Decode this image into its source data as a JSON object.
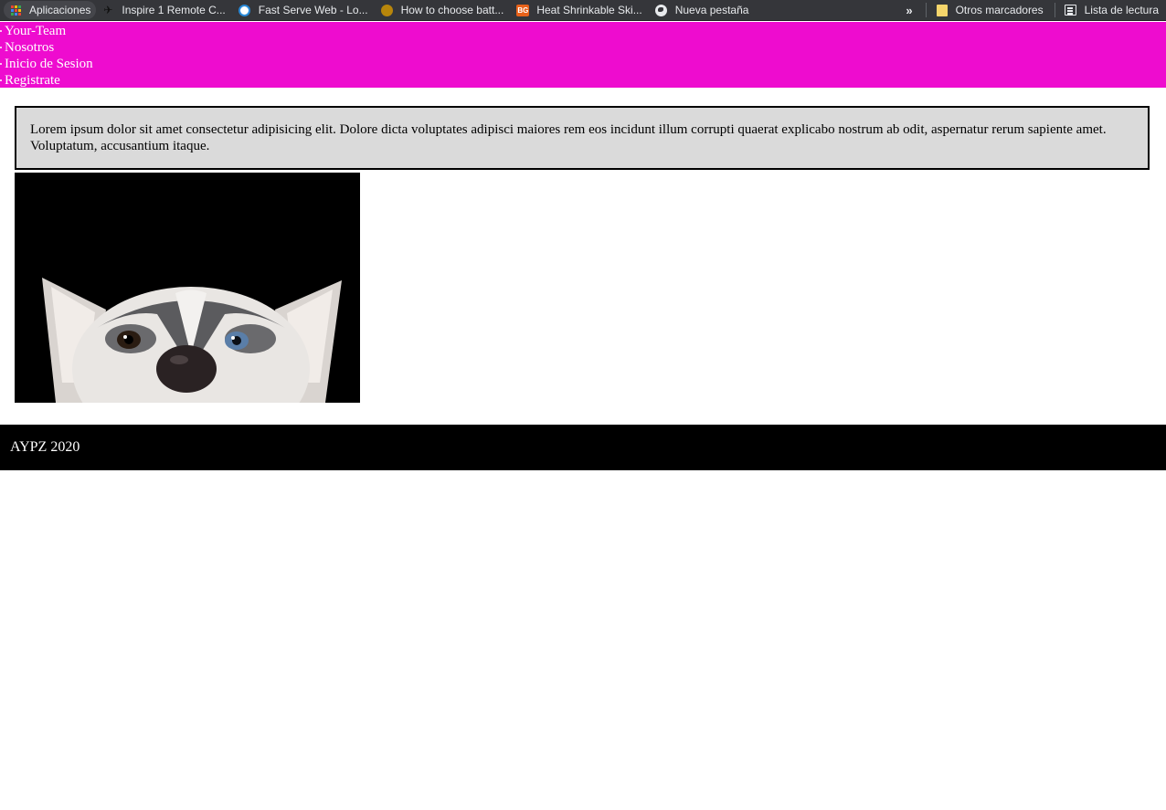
{
  "bookmarks_bar": {
    "items": [
      {
        "label": "Aplicaciones",
        "icon": "apps-grid-icon"
      },
      {
        "label": "Inspire 1 Remote C...",
        "icon": "drone-icon"
      },
      {
        "label": "Fast Serve Web - Lo...",
        "icon": "fastserve-icon"
      },
      {
        "label": "How to choose batt...",
        "icon": "owl-icon"
      },
      {
        "label": "Heat Shrinkable Ski...",
        "icon": "bg-icon",
        "icon_text": "BG"
      },
      {
        "label": "Nueva pestaña",
        "icon": "globe-icon"
      }
    ],
    "overflow": "»",
    "other_bookmarks": "Otros marcadores",
    "reading_list": "Lista de lectura"
  },
  "nav": {
    "items": [
      "Your-Team",
      "Nosotros",
      "Inicio de Sesion",
      "Registrate"
    ]
  },
  "main": {
    "paragraph": "Lorem ipsum dolor sit amet consectetur adipisicing elit. Dolore dicta voluptates adipisci maiores rem eos incidunt illum corrupti quaerat explicabo nostrum ab odit, aspernatur rerum sapiente amet. Voluptatum, accusantium itaque.",
    "image": "husky-dog-photo"
  },
  "footer": {
    "text": "AYPZ 2020"
  },
  "colors": {
    "nav_bg": "#ee0ccf",
    "footer_bg": "#000000",
    "text_box_bg": "#dadada",
    "bookmarks_bg": "#35363a"
  }
}
